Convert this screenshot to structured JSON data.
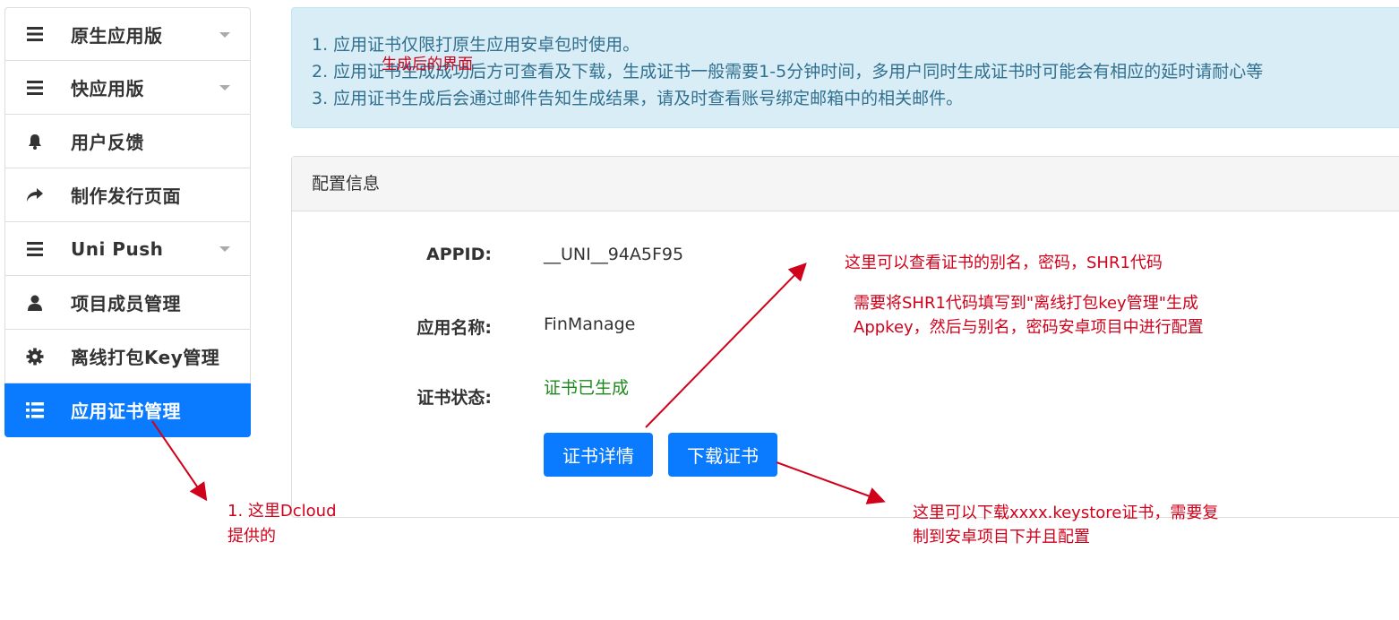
{
  "sidebar": {
    "items": [
      {
        "label": "原生应用版",
        "icon": "bars-icon",
        "dropdown": true
      },
      {
        "label": "快应用版",
        "icon": "bars-icon",
        "dropdown": true
      },
      {
        "label": "用户反馈",
        "icon": "bell-icon",
        "dropdown": false
      },
      {
        "label": "制作发行页面",
        "icon": "share-arrow-icon",
        "dropdown": false
      },
      {
        "label": "Uni Push",
        "icon": "bars-icon",
        "dropdown": true
      },
      {
        "label": "项目成员管理",
        "icon": "user-icon",
        "dropdown": false
      },
      {
        "label": "离线打包Key管理",
        "icon": "gear-icon",
        "dropdown": false
      },
      {
        "label": "应用证书管理",
        "icon": "list-icon",
        "dropdown": false,
        "active": true
      }
    ]
  },
  "notice": {
    "line1": "1. 应用证书仅限打原生应用安卓包时使用。",
    "line2": "2. 应用证书生成成功后方可查看及下载，生成证书一般需要1-5分钟时间，多用户同时生成证书时可能会有相应的延时请耐心等",
    "line3": "3. 应用证书生成后会通过邮件告知生成结果，请及时查看账号绑定邮箱中的相关邮件。",
    "overlay_note": "生成后的界面"
  },
  "panel": {
    "title": "配置信息",
    "appid_label": "APPID:",
    "appid_value": "__UNI__94A5F95",
    "name_label": "应用名称:",
    "name_value": "FinManage",
    "status_label": "证书状态:",
    "status_value": "证书已生成",
    "detail_button": "证书详情",
    "download_button": "下载证书"
  },
  "annotations": {
    "note1": "这里可以查看证书的别名，密码，SHR1代码",
    "note2_line1": "需要将SHR1代码填写到\"离线打包key管理\"生成",
    "note2_line2": "Appkey，然后与别名，密码安卓项目中进行配置",
    "note3_line1": "1. 这里Dcloud",
    "note3_line2": "提供的",
    "note4_line1": "这里可以下载xxxx.keystore证书，需要复",
    "note4_line2": "制到安卓项目下并且配置"
  },
  "colors": {
    "accent": "#0a7bff",
    "notice_bg": "#d9edf7",
    "notice_text": "#31708f",
    "success": "#1e8a1e",
    "annotation": "#d0021b"
  }
}
